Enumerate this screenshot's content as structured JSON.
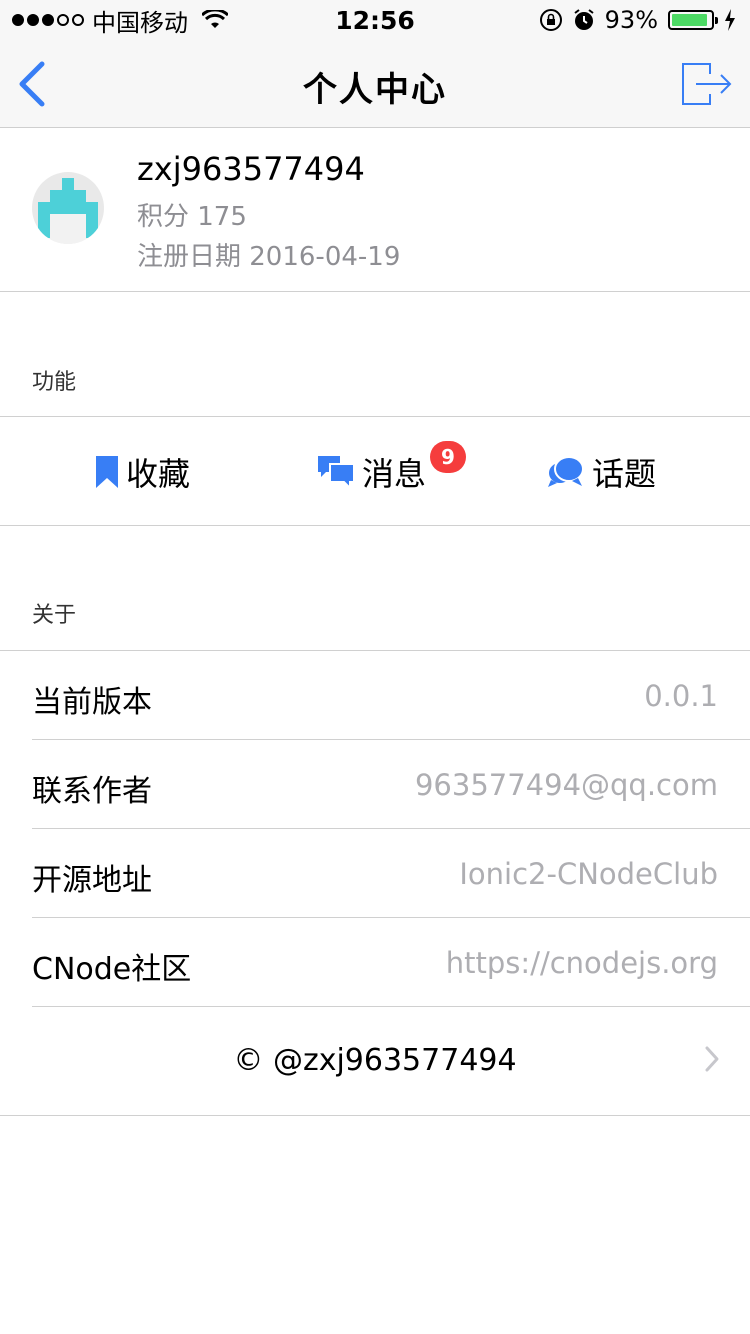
{
  "status_bar": {
    "carrier": "中国移动",
    "time": "12:56",
    "battery": "93%"
  },
  "nav": {
    "title": "个人中心"
  },
  "profile": {
    "username": "zxj963577494",
    "score_text": "积分 175",
    "register_text": "注册日期 2016-04-19"
  },
  "sections": {
    "features_label": "功能",
    "about_label": "关于"
  },
  "features": {
    "favorites": "收藏",
    "messages": "消息",
    "messages_badge": "9",
    "topics": "话题"
  },
  "about": [
    {
      "label": "当前版本",
      "value": "0.0.1"
    },
    {
      "label": "联系作者",
      "value": "963577494@qq.com"
    },
    {
      "label": "开源地址",
      "value": "Ionic2-CNodeClub"
    },
    {
      "label": "CNode社区",
      "value": "https://cnodejs.org"
    }
  ],
  "copyright": "© @zxj963577494",
  "colors": {
    "accent": "#387ef5",
    "badge": "#f53d3d",
    "secondary_text": "#8e8e93",
    "value_text": "#aeaeb2",
    "avatar_teal": "#4dd0d8"
  }
}
